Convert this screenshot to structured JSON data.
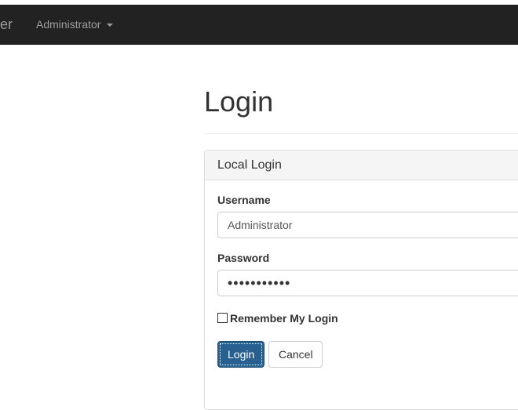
{
  "navbar": {
    "brand_fragment": "er",
    "user_menu_label": "Administrator"
  },
  "page": {
    "title": "Login"
  },
  "login_panel": {
    "heading": "Local Login",
    "username_label": "Username",
    "username_value": "Administrator",
    "password_label": "Password",
    "password_value": "•••••••••••",
    "remember_label": "Remember My Login",
    "remember_checked": false,
    "login_button": "Login",
    "cancel_button": "Cancel"
  },
  "colors": {
    "navbar_bg": "#222222",
    "navbar_text": "#9d9d9d",
    "primary_button": "#286090",
    "panel_heading_bg": "#f5f5f5"
  },
  "icons": {
    "user_menu_caret": "chevron-down-icon",
    "remember_checkbox": "checkbox-icon"
  }
}
